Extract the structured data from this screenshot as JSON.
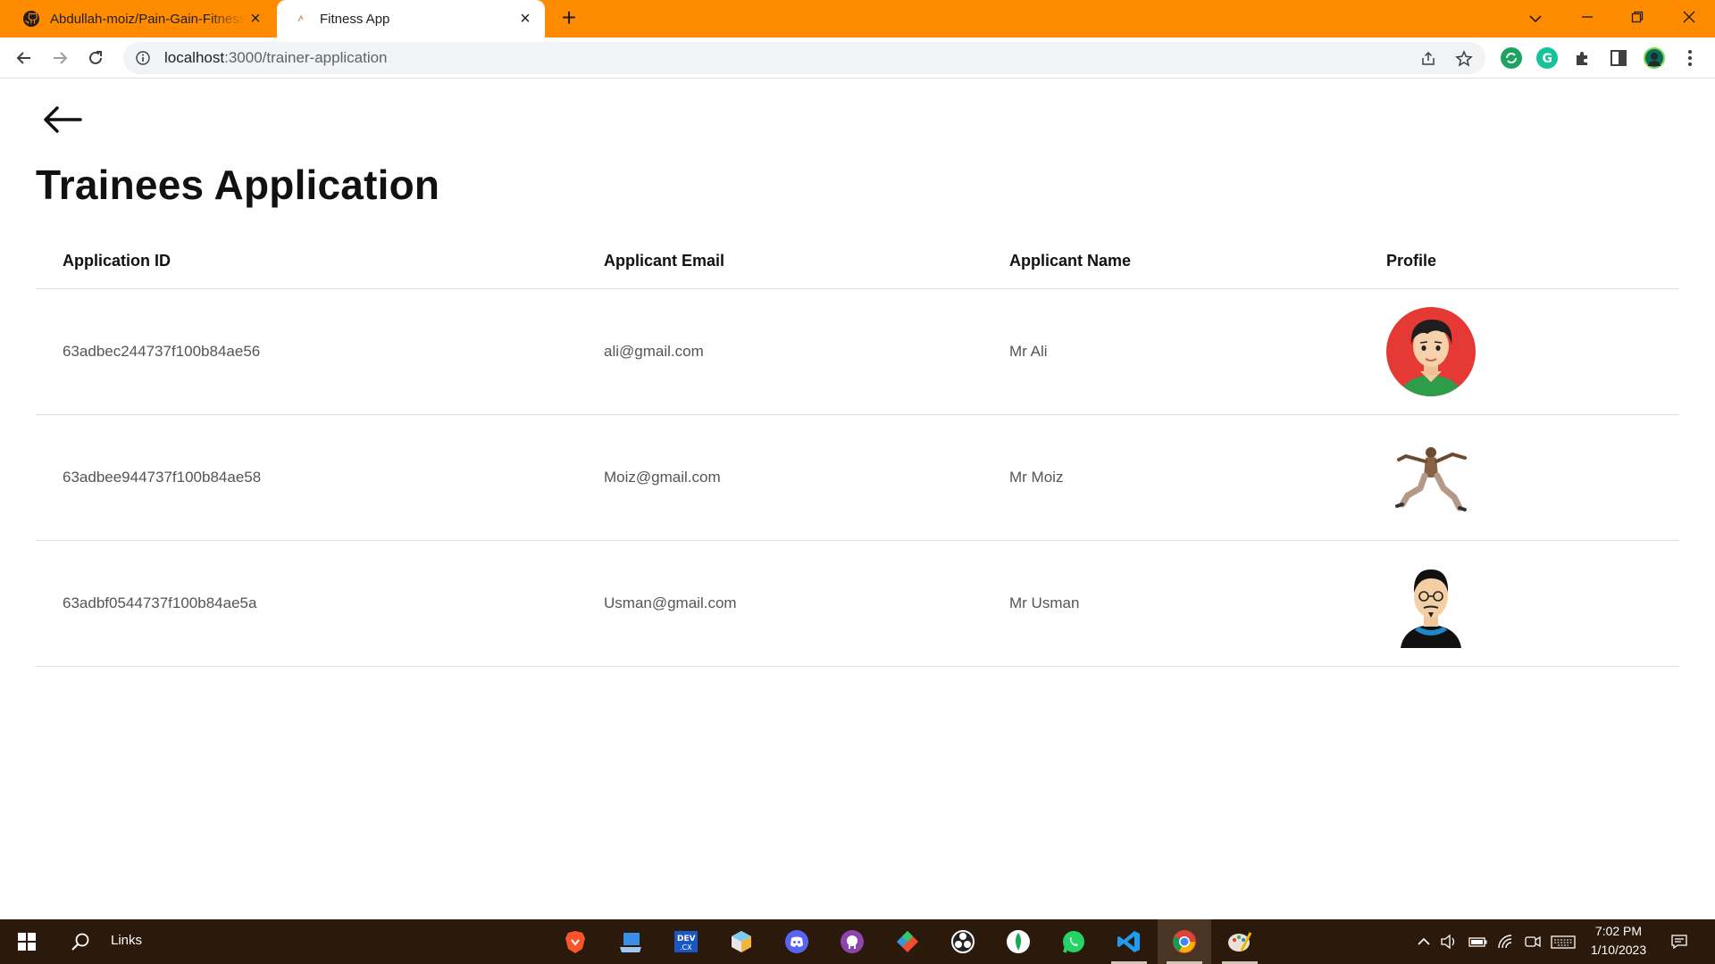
{
  "browser": {
    "tabs": [
      {
        "title": "Abdullah-moiz/Pain-Gain-Fitness",
        "icon": "github-icon",
        "active": false
      },
      {
        "title": "Fitness App",
        "icon": "app-favicon",
        "active": true
      }
    ],
    "url_host": "localhost",
    "url_path": ":3000/trainer-application",
    "accent_color": "#ff8c00"
  },
  "page": {
    "title": "Trainees Application",
    "back_icon": "arrow-left-icon"
  },
  "table": {
    "headers": [
      "Application ID",
      "Applicant Email",
      "Applicant Name",
      "Profile"
    ],
    "rows": [
      {
        "id": "63adbec244737f100b84ae56",
        "email": "ali@gmail.com",
        "name": "Mr Ali",
        "avatar": "cartoon-boy-avatar"
      },
      {
        "id": "63adbee944737f100b84ae58",
        "email": "Moiz@gmail.com",
        "name": "Mr Moiz",
        "avatar": "martial-artist-avatar"
      },
      {
        "id": "63adbf0544737f100b84ae5a",
        "email": "Usman@gmail.com",
        "name": "Mr Usman",
        "avatar": "glasses-man-avatar"
      }
    ]
  },
  "taskbar": {
    "search_label": "Links",
    "time": "7:02 PM",
    "date": "1/10/2023"
  }
}
